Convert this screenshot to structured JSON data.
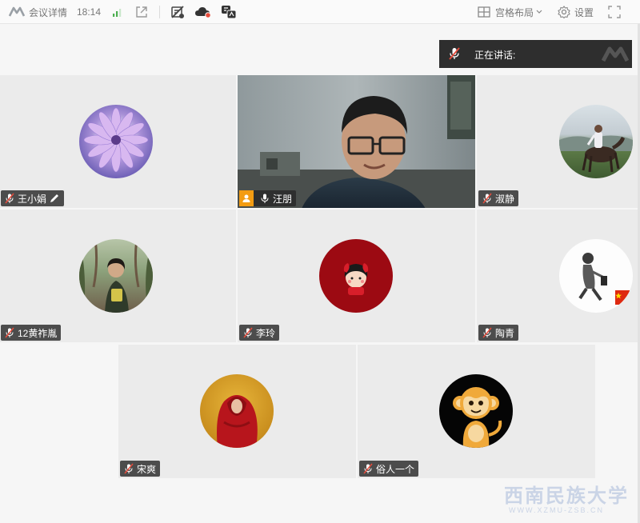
{
  "topbar": {
    "meeting_details": "会议详情",
    "time": "18:14",
    "layout_label": "宫格布局",
    "settings_label": "设置"
  },
  "speaking": {
    "label": "正在讲话:"
  },
  "participants": [
    {
      "name": "王小娟",
      "avatar": "purple-flower",
      "mic": "muted",
      "has_pen": true
    },
    {
      "name": "汪朋",
      "avatar": "live-video",
      "mic": "on",
      "is_host": true
    },
    {
      "name": "淑静",
      "avatar": "horse-rider-photo",
      "mic": "muted"
    },
    {
      "name": "12黄祚胤",
      "avatar": "person-outdoor-photo",
      "mic": "muted"
    },
    {
      "name": "李玲",
      "avatar": "red-cartoon-girl",
      "mic": "muted"
    },
    {
      "name": "陶青",
      "avatar": "sketch-person-flag",
      "mic": "muted"
    },
    {
      "name": "宋爽",
      "avatar": "red-cloak-photo",
      "mic": "muted"
    },
    {
      "name": "俗人一个",
      "avatar": "cartoon-monkey",
      "mic": "muted"
    }
  ],
  "watermark": {
    "main": "西南民族大学",
    "sub": "WWW.XZMU-ZSB.CN"
  },
  "colors": {
    "tile_bg": "#ebebeb",
    "nametag_bg": "#333333",
    "signal_green": "#4caf50",
    "host_orange": "#f39c12"
  }
}
